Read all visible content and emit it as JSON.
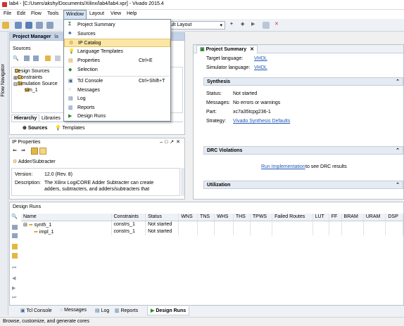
{
  "window": {
    "title": "lab4 - [C:/Users/akshy/Documents/Xilinx/lab4/lab4.xpr] - Vivado 2015.4"
  },
  "menubar": {
    "items": [
      "File",
      "Edit",
      "Flow",
      "Tools",
      "Window",
      "Layout",
      "View",
      "Help"
    ]
  },
  "toolbar": {
    "layout_value": "ult Layout"
  },
  "flow_navigator": {
    "label": "Flow Navigator"
  },
  "project_manager": {
    "title": "Project Manager",
    "title_suffix": "la",
    "sources_label": "Sources",
    "tree": [
      "Design Sources",
      "Constraints",
      "Simulation Source",
      "sim_1"
    ],
    "tabs": [
      "Hierarchy",
      "Libraries"
    ],
    "subtabs": [
      "Sources",
      "Templates"
    ]
  },
  "ip_properties": {
    "title": "IP Properties",
    "name": "Adder/Subtracter",
    "version_label": "Version:",
    "version_value": "12.0 (Rev. 8)",
    "description_label": "Description:",
    "description_line1": "The Xilinx LogiCORE Adder Subtracter can create",
    "description_line2": "adders, subtracters, and adders/subtracters that"
  },
  "project_summary": {
    "tab_label": "Project Summary",
    "target_language_label": "Target language:",
    "target_language_value": "VHDL",
    "simulator_language_label": "Simulator language:",
    "simulator_language_value": "VHDL",
    "synthesis_title": "Synthesis",
    "status_label": "Status:",
    "status_value": "Not started",
    "messages_label": "Messages:",
    "messages_value": "No errors or warnings",
    "part_label": "Part:",
    "part_value": "xc7a35tcpg236-1",
    "strategy_label": "Strategy:",
    "strategy_value": "Vivado Synthesis Defaults",
    "drc_title": "DRC Violations",
    "drc_link": "Run Implementation",
    "drc_text": "to see DRC results",
    "utilization_title": "Utilization"
  },
  "design_runs": {
    "title": "Design Runs",
    "columns": [
      "Name",
      "Constraints",
      "Status",
      "WNS",
      "TNS",
      "WHS",
      "THS",
      "TPWS",
      "Failed Routes",
      "LUT",
      "FF",
      "BRAM",
      "URAM",
      "DSP"
    ],
    "rows": [
      {
        "name": "synth_1",
        "constraints": "constrs_1",
        "status": "Not started"
      },
      {
        "name": "impl_1",
        "constraints": "constrs_1",
        "status": "Not started"
      }
    ]
  },
  "bottom_tabs": [
    "Tcl Console",
    "Messages",
    "Log",
    "Reports",
    "Design Runs"
  ],
  "window_menu": {
    "items": [
      {
        "label": "Project Summary",
        "shortcut": ""
      },
      {
        "label": "Sources",
        "shortcut": ""
      },
      {
        "label": "IP Catalog",
        "shortcut": ""
      },
      {
        "label": "Language Templates",
        "shortcut": ""
      },
      {
        "label": "Properties",
        "shortcut": "Ctrl+E"
      },
      {
        "label": "Selection",
        "shortcut": ""
      },
      {
        "label": "Tcl Console",
        "shortcut": "Ctrl+Shift+T"
      },
      {
        "label": "Messages",
        "shortcut": ""
      },
      {
        "label": "Log",
        "shortcut": ""
      },
      {
        "label": "Reports",
        "shortcut": ""
      },
      {
        "label": "Design Runs",
        "shortcut": ""
      }
    ]
  },
  "statusbar": {
    "text": "Browse, customize, and generate cores"
  }
}
